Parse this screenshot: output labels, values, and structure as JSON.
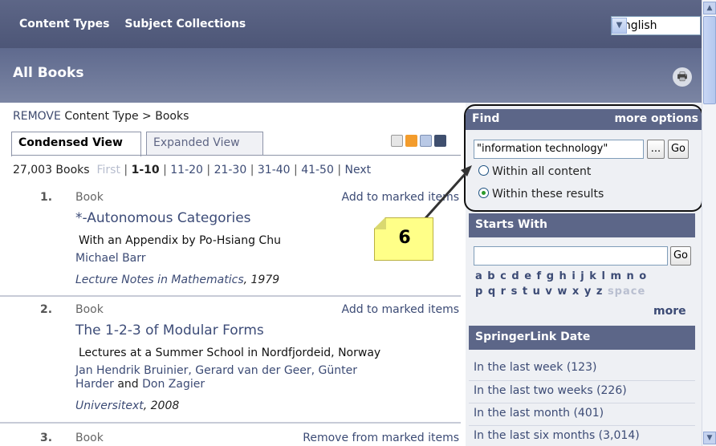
{
  "topnav": {
    "items": [
      "Content Types",
      "Subject Collections"
    ],
    "language": "English"
  },
  "title": "All Books",
  "breadcrumb": {
    "remove": "REMOVE",
    "path": "Content Type > Books"
  },
  "tabs": [
    "Condensed View",
    "Expanded View"
  ],
  "pager": {
    "count": "27,003 Books",
    "first": "First",
    "current": "1-10",
    "pages": [
      "11-20",
      "21-30",
      "31-40",
      "41-50"
    ],
    "next": "Next"
  },
  "results": [
    {
      "num": "1.",
      "type": "Book",
      "action": "Add to marked items",
      "title": "*-Autonomous Categories",
      "subtitle": "With an Appendix by Po-Hsiang Chu",
      "authors": [
        {
          "name": "Michael Barr"
        }
      ],
      "series": "Lecture Notes in Mathematics",
      "year": ", 1979"
    },
    {
      "num": "2.",
      "type": "Book",
      "action": "Add to marked items",
      "title": "The 1-2-3 of Modular Forms",
      "subtitle": "Lectures at a Summer School in Nordfjordeid, Norway",
      "authors_line1": "Jan Hendrik Bruinier, Gerard van der Geer, Günter",
      "authors_line2a": "Harder",
      "and": "and",
      "authors_line2b": "Don Zagier",
      "series": "Universitext",
      "year": ", 2008"
    },
    {
      "num": "3.",
      "type": "Book",
      "action": "Remove from marked items"
    }
  ],
  "find": {
    "header": "Find",
    "more_options": "more options",
    "query": "\"information technology\"",
    "browse_label": "...",
    "go_label": "Go",
    "options": [
      "Within all content",
      "Within these results"
    ],
    "selected": "Within these results"
  },
  "starts_with": {
    "header": "Starts With",
    "go_label": "Go",
    "letters_row1": "a b c d e f g h i j k l m n o",
    "letters_row2": "p q r s t u v w x y z",
    "space": "space",
    "more": "more"
  },
  "springer_date": {
    "header": "SpringerLink Date",
    "options": [
      "In the last week (123)",
      "In the last two weeks (226)",
      "In the last month (401)",
      "In the last six months (3,014)"
    ]
  },
  "callout": "6",
  "colors": {
    "header_bg": "#4d5677",
    "link": "#3c4b75",
    "panel_bg": "#eef0f4",
    "callout_bg": "#ffff88"
  }
}
